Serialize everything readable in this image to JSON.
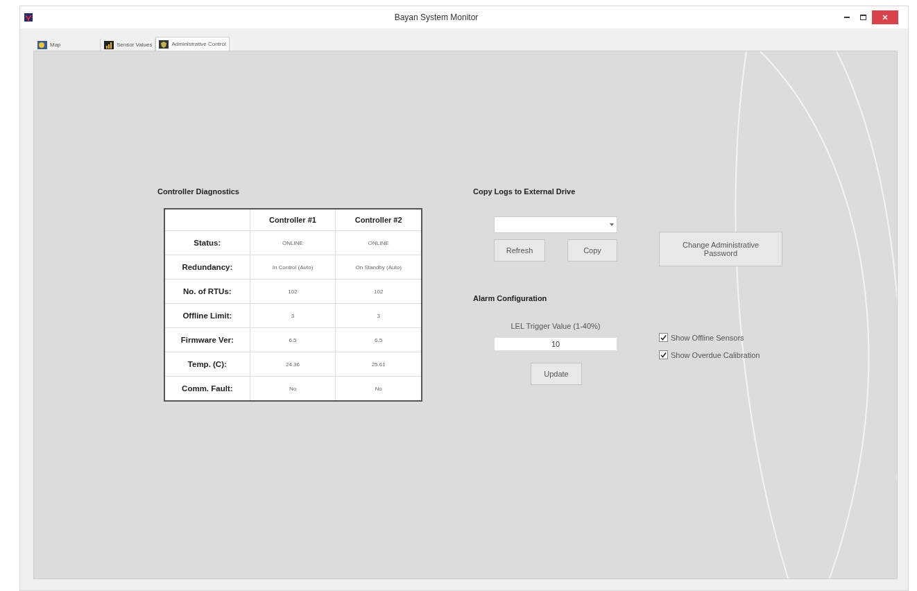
{
  "window": {
    "title": "Bayan System Monitor"
  },
  "tabs": [
    {
      "label": "Map",
      "selected": false
    },
    {
      "label": "Sensor Values",
      "selected": false
    },
    {
      "label": "Administrative Control",
      "selected": true
    }
  ],
  "diagnostics": {
    "title": "Controller Diagnostics",
    "columns": [
      "Controller #1",
      "Controller #2"
    ],
    "rows": [
      {
        "label": "Status:",
        "values": [
          "ONLINE",
          "ONLINE"
        ]
      },
      {
        "label": "Redundancy:",
        "values": [
          "In Control (Auto)",
          "On Standby (Auto)"
        ]
      },
      {
        "label": "No. of RTUs:",
        "values": [
          "102",
          "102"
        ]
      },
      {
        "label": "Offline Limit:",
        "values": [
          "3",
          "3"
        ]
      },
      {
        "label": "Firmware Ver:",
        "values": [
          "6.5",
          "6.5"
        ]
      },
      {
        "label": "Temp. (C):",
        "values": [
          "24.36",
          "25.61"
        ]
      },
      {
        "label": "Comm. Fault:",
        "values": [
          "No",
          "No"
        ]
      }
    ]
  },
  "copy_logs": {
    "title": "Copy Logs to External Drive",
    "buttons": [
      "Refresh",
      "Copy"
    ]
  },
  "alarm": {
    "title": "Alarm Configuration",
    "field_label": "LEL Trigger Value (1-40%)",
    "value": "10",
    "button": "Update"
  },
  "password_button": "Change Administrative Password",
  "options": [
    {
      "label": "Show Offline Sensors",
      "checked": true
    },
    {
      "label": "Show Overdue Calibration",
      "checked": true
    }
  ]
}
